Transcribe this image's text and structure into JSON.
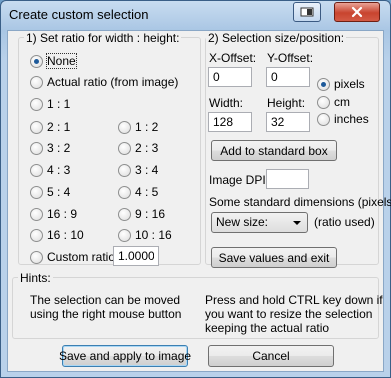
{
  "window": {
    "title": "Create custom selection"
  },
  "ratio_group": {
    "title": "1) Set ratio for width : height:",
    "options": [
      {
        "label": "None",
        "selected": true
      },
      {
        "label": "Actual ratio (from image)"
      },
      {
        "label": "1 : 1"
      },
      {
        "label": "2 : 1"
      },
      {
        "label": "1 : 2"
      },
      {
        "label": "3 : 2"
      },
      {
        "label": "2 : 3"
      },
      {
        "label": "4 : 3"
      },
      {
        "label": "3 : 4"
      },
      {
        "label": "5 : 4"
      },
      {
        "label": "4 : 5"
      },
      {
        "label": "16 : 9"
      },
      {
        "label": "9 : 16"
      },
      {
        "label": "16 : 10"
      },
      {
        "label": "10 : 16"
      }
    ],
    "custom_label": "Custom ratio:",
    "custom_value": "1.0000"
  },
  "size_group": {
    "title": "2) Selection size/position:",
    "x_offset_label": "X-Offset:",
    "x_offset_value": "0",
    "y_offset_label": "Y-Offset:",
    "y_offset_value": "0",
    "width_label": "Width:",
    "width_value": "128",
    "height_label": "Height:",
    "height_value": "32",
    "units": [
      {
        "label": "pixels",
        "selected": true
      },
      {
        "label": "cm"
      },
      {
        "label": "inches"
      }
    ],
    "add_button": "Add to standard box",
    "dpi_label": "Image DPI:",
    "dpi_value": "",
    "std_dims_label": "Some standard dimensions (pixels):",
    "std_select_value": "New size:",
    "ratio_used": "(ratio used)",
    "save_values_button": "Save values and exit"
  },
  "hints": {
    "title": "Hints:",
    "left": "The selection can be moved\nusing the right mouse button",
    "right": "Press and hold CTRL key down if\nyou want to resize the selection\nkeeping the actual ratio"
  },
  "buttons": {
    "save_apply": "Save and apply to image",
    "cancel": "Cancel"
  }
}
